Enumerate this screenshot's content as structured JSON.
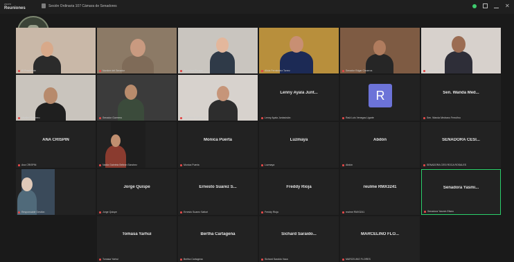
{
  "app": {
    "name": "Reuniones",
    "name_small": "zoom",
    "meeting_title": "Sesión Ordinaria 107 Cámara de Senadores"
  },
  "toolbar": {
    "icons": [
      "status-indicator",
      "window-icon",
      "minimize-icon",
      "close-icon"
    ],
    "status_color": "#3ecb6e"
  },
  "participants": [
    {
      "name": "",
      "label": "El Presidente",
      "video": true
    },
    {
      "name": "",
      "label": "Nombre del Senador",
      "video": true
    },
    {
      "name": "",
      "label": "Senadora Europa",
      "video": true
    },
    {
      "name": "",
      "label": "Alicia Fernández Torrez",
      "video": true
    },
    {
      "name": "",
      "label": "Senador Edgar Cisneros",
      "video": true
    },
    {
      "name": "",
      "label": "Patricia LOPEZ",
      "video": true
    },
    {
      "name": "",
      "label": "Maribel Guerrero",
      "video": true
    },
    {
      "name": "",
      "label": "Senador Guerrero",
      "video": true
    },
    {
      "name": "",
      "label": "Rigoberto Guzmán",
      "video": true
    },
    {
      "name": "Lenny Ayala Junt...",
      "label": "Lenny Ayala Juntavisión",
      "video": false
    },
    {
      "name": "",
      "label": "Raúl Luis Venegas Ligarte",
      "video": false,
      "avatar": "R"
    },
    {
      "name": "Sen. Wanda Med...",
      "label": "Sen. Wanda Medrano Ferrufino",
      "video": false
    },
    {
      "name": "ANA CRISPIN",
      "label": "Ana CRISPIN",
      "video": false
    },
    {
      "name": "",
      "label": "Nadia Gabriela Beltrán Sánchez",
      "video": true
    },
    {
      "name": "Monica Puerta",
      "label": "Monica Puerta",
      "video": false
    },
    {
      "name": "Luzmaya",
      "label": "Luzmaya",
      "video": false
    },
    {
      "name": "Abdón",
      "label": "Abdón",
      "video": false
    },
    {
      "name": "SENADORA CESI...",
      "label": "SENADORA CESI ROCA ROSALES",
      "video": false
    },
    {
      "name": "",
      "label": "Responsable Gestión",
      "video": true
    },
    {
      "name": "Jorge Quispe",
      "label": "Jorge Quispe",
      "video": false
    },
    {
      "name": "Ernesto Suarez S...",
      "label": "Ernesto Suarez Sattori",
      "video": false
    },
    {
      "name": "Freddy Rioja",
      "label": "Freddy Rioja",
      "video": false
    },
    {
      "name": "reulme RMX3241",
      "label": "realme RMX3241",
      "video": false
    },
    {
      "name": "Senadora Yasmi...",
      "label": "Senadora Yasmin Eliseo",
      "video": false,
      "active": true
    },
    {
      "name": "Tomasa Yarhui",
      "label": "Tomasa Yarhui",
      "video": false
    },
    {
      "name": "Bertha Cartagena",
      "label": "Bertha Cartagena",
      "video": false
    },
    {
      "name": "Sichard Saraido...",
      "label": "Sichard Saraido Vaca",
      "video": false
    },
    {
      "name": "MARCELINO FLO...",
      "label": "MARCELINO FLORES",
      "video": false
    }
  ],
  "colors": {
    "background": "#1a1a1a",
    "tile": "#222222",
    "active_border": "#2bd06b",
    "mic_muted": "#e04848",
    "avatar": "#6c73d8"
  }
}
